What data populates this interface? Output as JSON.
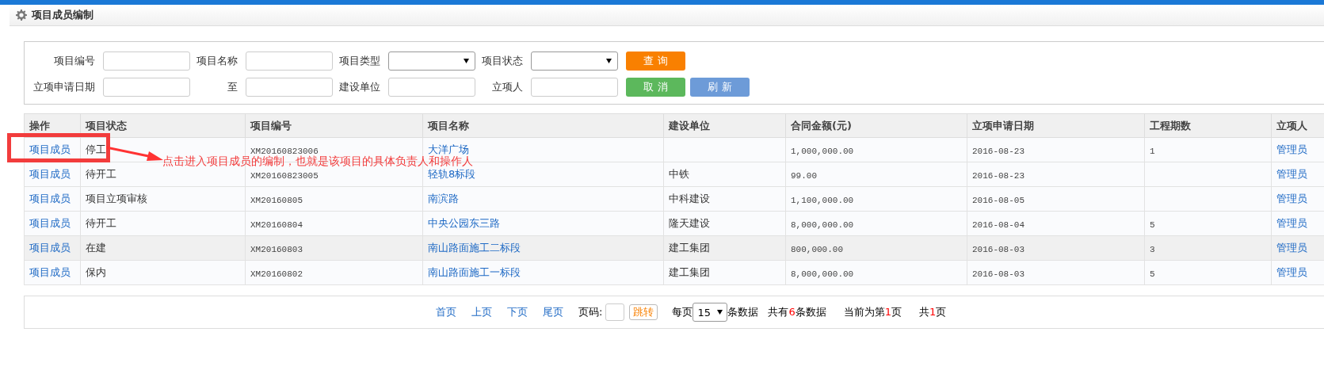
{
  "page_title": "项目成员编制",
  "filters": [
    [
      {
        "label": "项目编号",
        "kind": "text"
      },
      {
        "label": "项目名称",
        "kind": "text"
      },
      {
        "label": "项目类型",
        "kind": "select"
      },
      {
        "label": "项目状态",
        "kind": "select"
      }
    ],
    [
      {
        "label": "立项申请日期",
        "kind": "text"
      },
      {
        "label": "至",
        "kind": "text"
      },
      {
        "label": "建设单位",
        "kind": "text"
      },
      {
        "label": "立项人",
        "kind": "text"
      }
    ]
  ],
  "buttons": [
    [
      {
        "label": "查 询",
        "color": "#f98001"
      }
    ],
    [
      {
        "label": "取 消",
        "color": "#5cb85c"
      },
      {
        "label": "刷 新",
        "color": "#6d9bd8"
      }
    ]
  ],
  "table": {
    "columns": [
      "操作",
      "项目状态",
      "项目编号",
      "项目名称",
      "建设单位",
      "合同金额(元)",
      "立项申请日期",
      "工程期数",
      "立项人"
    ],
    "rows": [
      {
        "highlighted": false,
        "cells": [
          "项目成员",
          "停工",
          "XM20160823006",
          "大洋广场",
          "",
          "1,000,000.00",
          "2016-08-23",
          "1",
          "管理员"
        ]
      },
      {
        "highlighted": false,
        "cells": [
          "项目成员",
          "待开工",
          "XM20160823005",
          "轻轨8标段",
          "中铁",
          "99.00",
          "2016-08-23",
          "",
          "管理员"
        ]
      },
      {
        "highlighted": false,
        "cells": [
          "项目成员",
          "项目立项审核",
          "XM20160805",
          "南滨路",
          "中科建设",
          "1,100,000.00",
          "2016-08-05",
          "",
          "管理员"
        ]
      },
      {
        "highlighted": false,
        "cells": [
          "项目成员",
          "待开工",
          "XM20160804",
          "中央公园东三路",
          "隆天建设",
          "8,000,000.00",
          "2016-08-04",
          "5",
          "管理员"
        ]
      },
      {
        "highlighted": true,
        "cells": [
          "项目成员",
          "在建",
          "XM20160803",
          "南山路面施工二标段",
          "建工集团",
          "800,000.00",
          "2016-08-03",
          "3",
          "管理员"
        ]
      },
      {
        "highlighted": false,
        "cells": [
          "项目成员",
          "保内",
          "XM20160802",
          "南山路面施工一标段",
          "建工集团",
          "8,000,000.00",
          "2016-08-03",
          "5",
          "管理员"
        ]
      }
    ]
  },
  "annotation": {
    "text": "点击进入项目成员的编制，也就是该项目的具体负责人和操作人"
  },
  "pager": {
    "links": [
      "首页",
      "上页",
      "下页",
      "尾页"
    ],
    "page_label": "页码:",
    "jump": "跳转",
    "per_page_prefix": "每页",
    "per_page": "15",
    "per_page_suffix": "条数据",
    "total": {
      "prefix": "共有",
      "count": "6",
      "suffix": "条数据"
    },
    "current": {
      "prefix": "当前为第",
      "count": "1",
      "suffix": "页"
    },
    "pages": {
      "prefix": "共",
      "count": "1",
      "suffix": "页"
    }
  }
}
